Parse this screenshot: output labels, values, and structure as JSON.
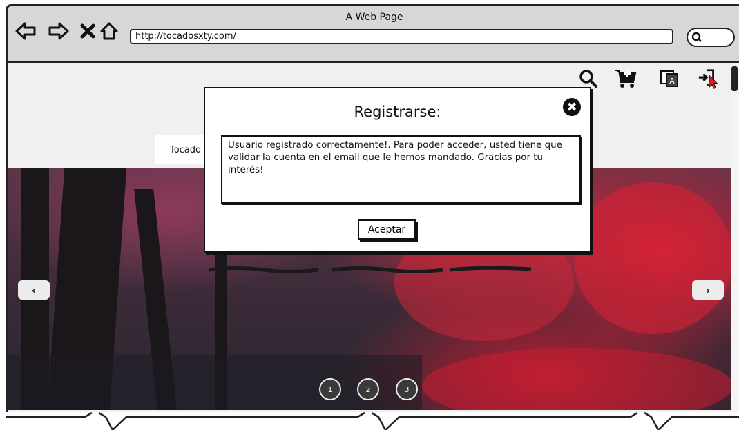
{
  "browser": {
    "window_title": "A Web Page",
    "url": "http://tocadosxty.com/"
  },
  "nav": {
    "tab_label": "Tocado"
  },
  "carousel": {
    "prev_label": "‹",
    "next_label": "›",
    "pages": [
      "1",
      "2",
      "3"
    ]
  },
  "modal": {
    "title": "Registrarse:",
    "message": "Usuario registrado correctamente!. Para poder acceder, usted tiene que validar la cuenta en el email que le hemos mandado. Gracias por tu interés!",
    "accept_label": "Aceptar",
    "close_label": "✖"
  },
  "icons": {
    "top_bar": [
      "search-icon",
      "add-to-cart-icon",
      "translate-icon",
      "login-icon"
    ],
    "browser": [
      "back-icon",
      "forward-icon",
      "stop-icon",
      "home-icon",
      "browser-search-icon"
    ]
  },
  "colors": {
    "chrome_bg": "#d7d7d7",
    "hero_red": "#c62a3e",
    "cursor_red": "#e02020"
  }
}
